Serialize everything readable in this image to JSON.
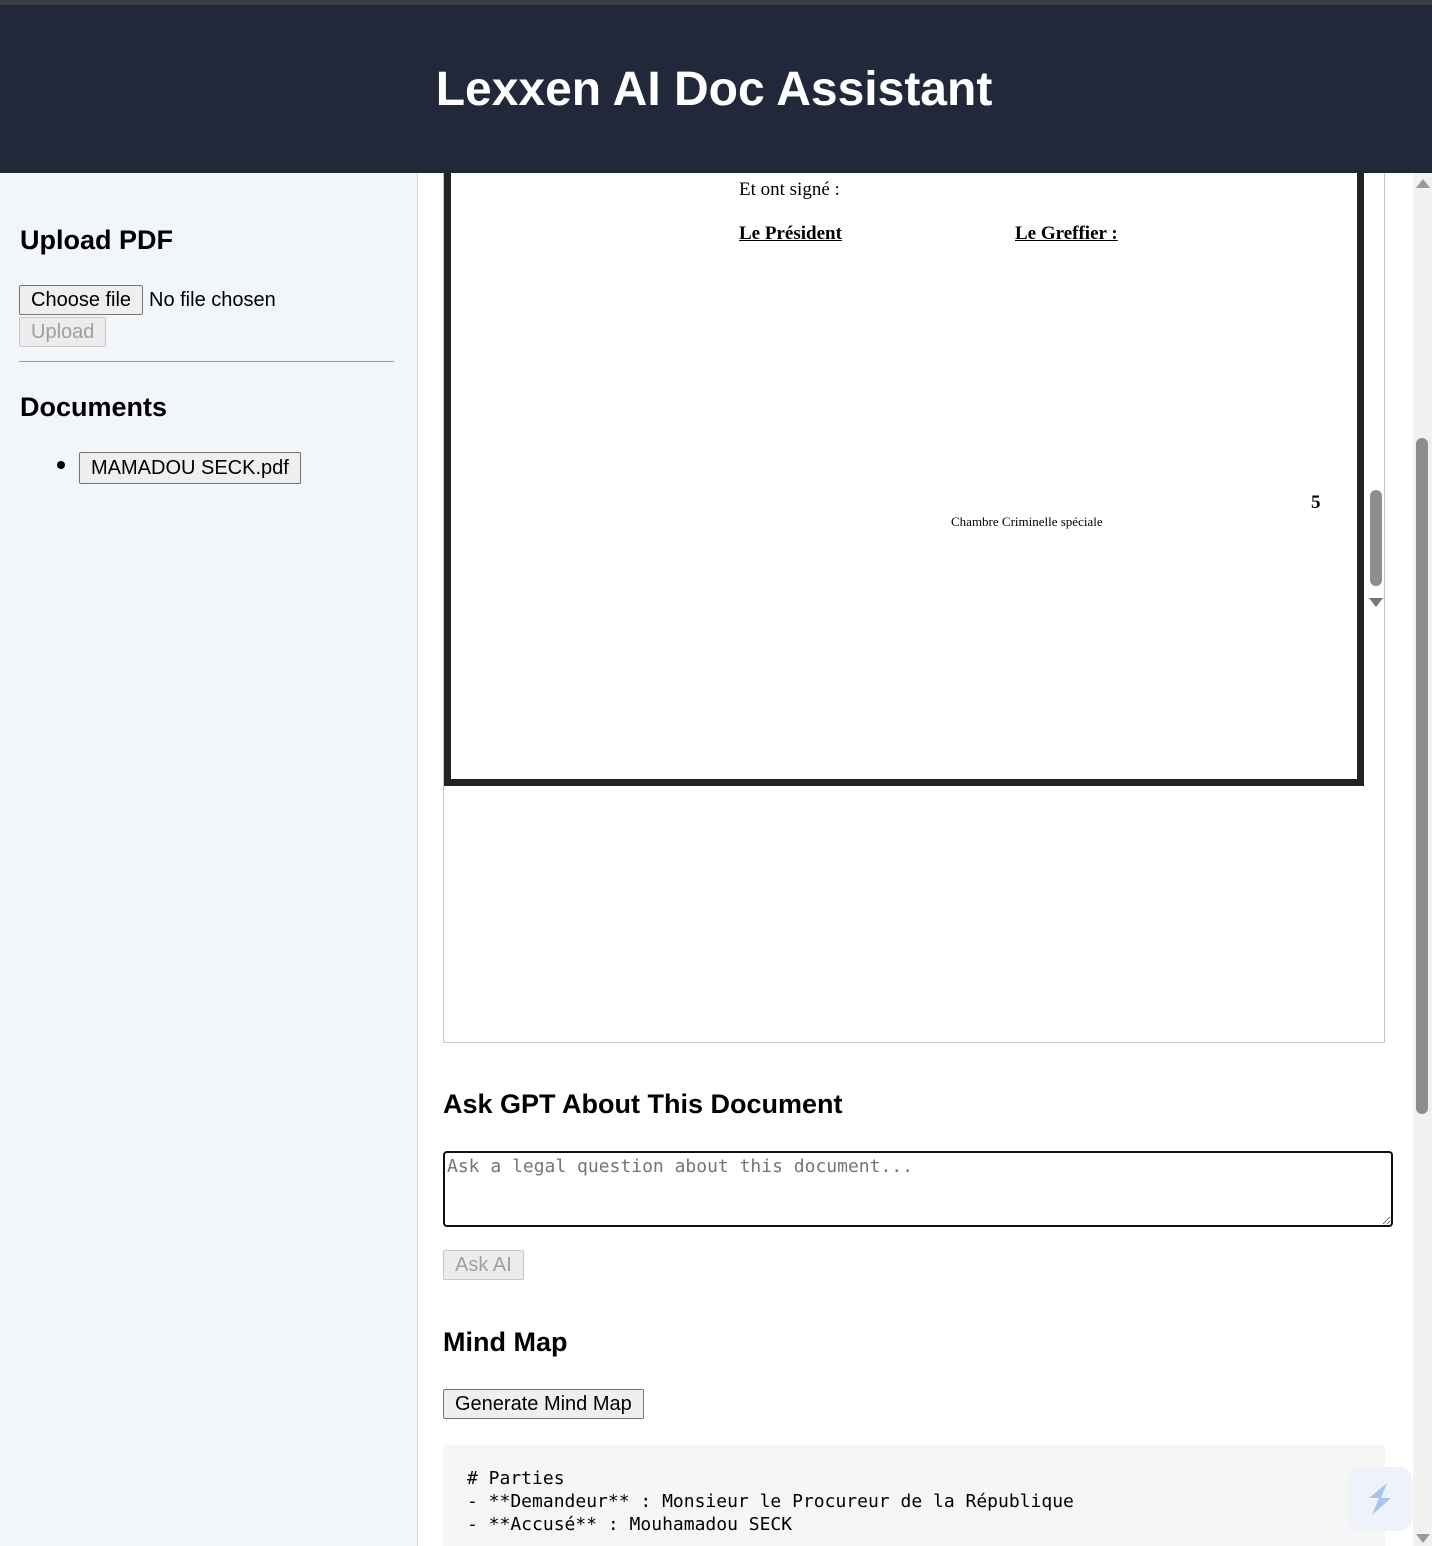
{
  "app": {
    "title": "Lexxen AI Doc Assistant"
  },
  "sidebar": {
    "upload_heading": "Upload PDF",
    "choose_file_label": "Choose file",
    "no_file_text": "No file chosen",
    "upload_button_label": "Upload",
    "documents_heading": "Documents",
    "documents": [
      {
        "name": "MAMADOU SECK.pdf"
      }
    ]
  },
  "viewer": {
    "page": {
      "signed_line": "Et ont signé :",
      "president_label": "Le Président",
      "greffier_label": "Le Greffier :",
      "page_number": "5",
      "footer": "Chambre Criminelle spéciale"
    }
  },
  "ask": {
    "heading": "Ask GPT About This Document",
    "placeholder": "Ask a legal question about this document...",
    "button_label": "Ask AI"
  },
  "mindmap": {
    "heading": "Mind Map",
    "button_label": "Generate Mind Map",
    "output_lines": [
      "# Parties",
      "- **Demandeur** : Monsieur le Procureur de la République",
      "- **Accusé** : Mouhamadou SECK"
    ]
  },
  "colors": {
    "header_bg": "#21283a",
    "sidebar_bg": "#f2f5f9"
  }
}
